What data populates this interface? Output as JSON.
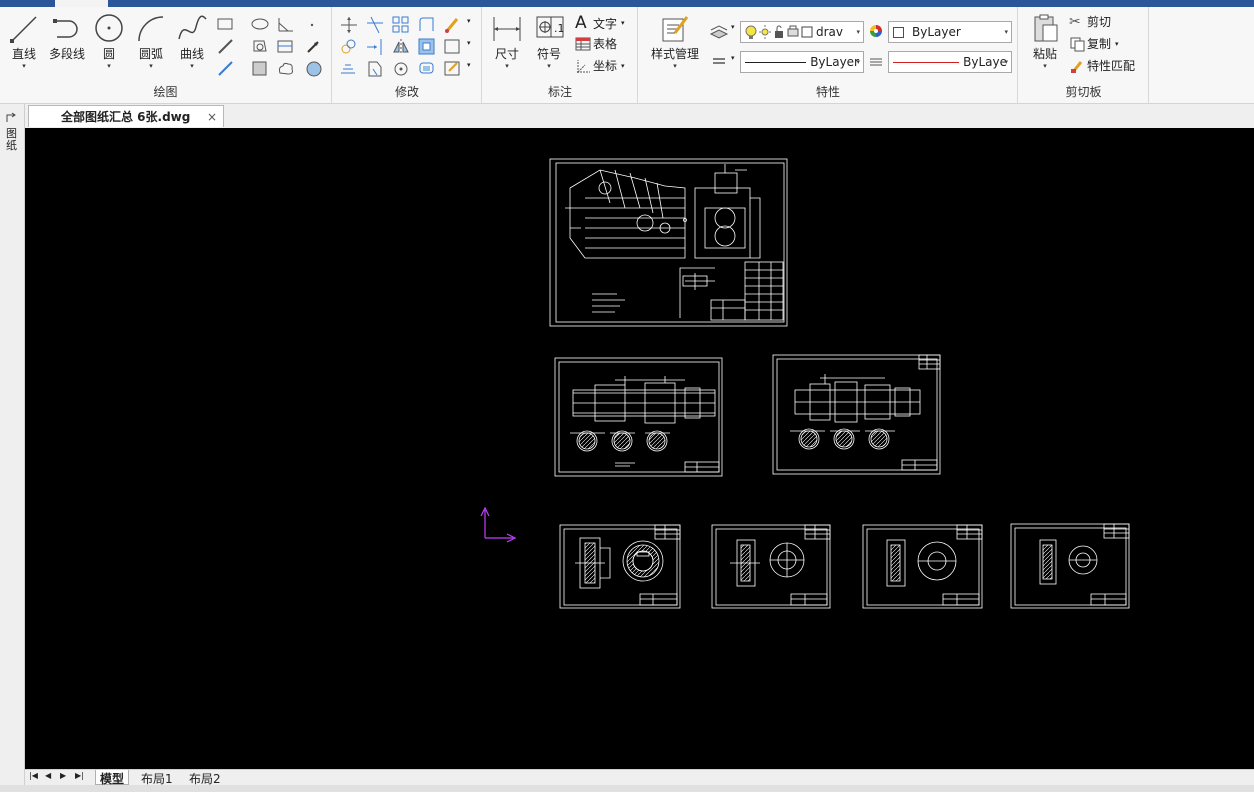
{
  "document": {
    "tab_title": "全部图纸汇总 6张.dwg",
    "close_glyph": "×"
  },
  "ribbon": {
    "draw": {
      "label": "绘图",
      "line": "直线",
      "polyline": "多段线",
      "circle": "圆",
      "arc": "圆弧",
      "curve": "曲线"
    },
    "modify": {
      "label": "修改"
    },
    "annotate": {
      "label": "标注",
      "dimension": "尺寸",
      "symbol": "符号",
      "text": "文字",
      "table": "表格",
      "coordinate": "坐标"
    },
    "properties": {
      "label": "特性",
      "style_manager": "样式管理",
      "layer_value": "drav",
      "color_value": "ByLayer",
      "linetype_value": "ByLayer",
      "lineweight_value": "ByLaye"
    },
    "clipboard": {
      "label": "剪切板",
      "paste": "粘贴",
      "cut": "剪切",
      "copy": "复制",
      "match": "特性匹配"
    }
  },
  "side_panel": {
    "label": "图纸"
  },
  "layout_tabs": [
    "模型",
    "布局1",
    "布局2"
  ],
  "colors": {
    "accent": "#2b579a",
    "ucs": "#c040ff",
    "drawing": "#ffffff",
    "canvas": "#000000",
    "linetype_red": "#d02020"
  }
}
